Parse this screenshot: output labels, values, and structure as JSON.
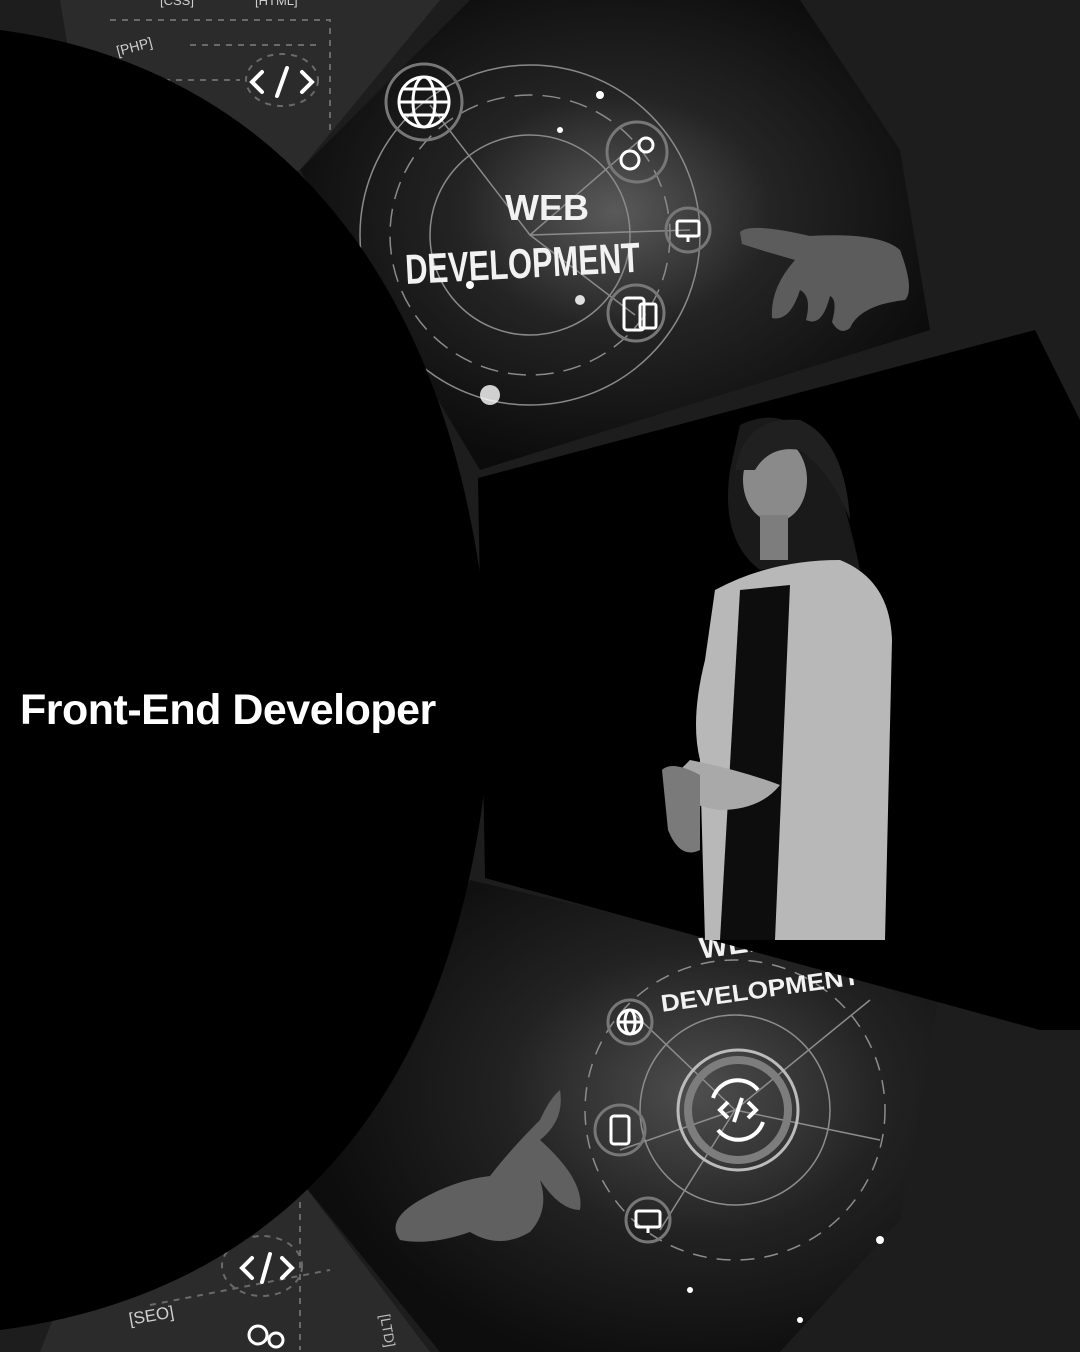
{
  "headline": "Front-End Developer",
  "top_banner": {
    "line1": "WEB",
    "line2": "DEVELOPMENT",
    "tags": [
      "[CSS]",
      "[HTML]",
      "[PHP]"
    ],
    "icons": [
      "globe-icon",
      "gears-icon",
      "monitor-icon",
      "code-icon",
      "mobile-code-icon"
    ]
  },
  "bottom_banner": {
    "line1": "WEB",
    "line2": "DEVELOPMENT",
    "tags": [
      "[SEO]",
      "[LTD]"
    ],
    "icons": [
      "globe-icon",
      "code-refresh-icon",
      "phone-icon",
      "monitor-icon"
    ]
  },
  "colors": {
    "background": "#1d1d1d",
    "black_disc": "#000000",
    "text": "#ffffff"
  }
}
